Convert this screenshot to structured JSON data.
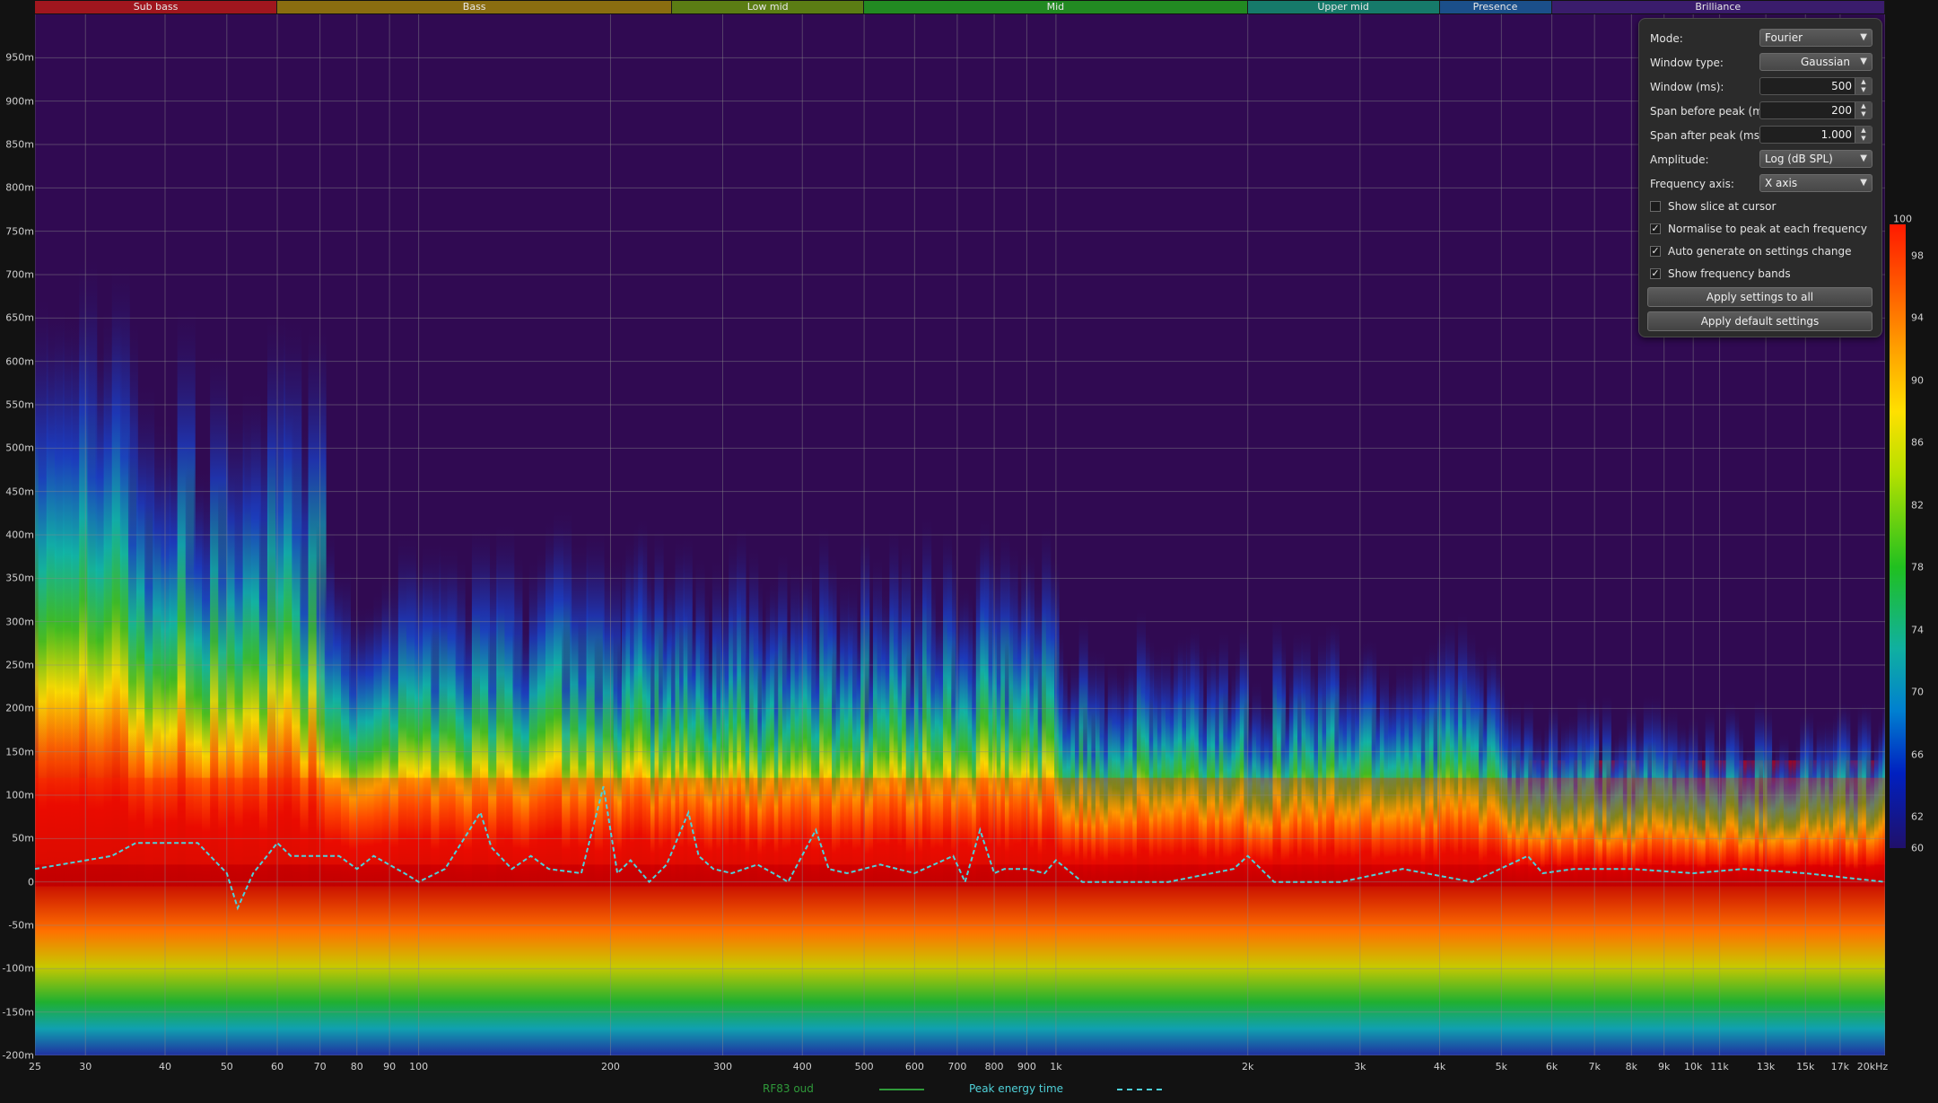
{
  "bands": [
    {
      "label": "Sub bass",
      "color": "#a0161e",
      "from": 20,
      "to": 60
    },
    {
      "label": "Bass",
      "color": "#8a6d10",
      "from": 60,
      "to": 250
    },
    {
      "label": "Low mid",
      "color": "#5b7d14",
      "from": 250,
      "to": 500
    },
    {
      "label": "Mid",
      "color": "#228a22",
      "from": 500,
      "to": 2000
    },
    {
      "label": "Upper mid",
      "color": "#167a6a",
      "from": 2000,
      "to": 4000
    },
    {
      "label": "Presence",
      "color": "#1b4f8a",
      "from": 4000,
      "to": 6000
    },
    {
      "label": "Brilliance",
      "color": "#3a1c6c",
      "from": 6000,
      "to": 20000
    }
  ],
  "axes": {
    "x": {
      "min": 25,
      "max": 20000,
      "scale": "log",
      "ticks": [
        {
          "v": 25,
          "label": "25"
        },
        {
          "v": 30,
          "label": "30"
        },
        {
          "v": 40,
          "label": "40"
        },
        {
          "v": 50,
          "label": "50"
        },
        {
          "v": 60,
          "label": "60"
        },
        {
          "v": 70,
          "label": "70"
        },
        {
          "v": 80,
          "label": "80"
        },
        {
          "v": 90,
          "label": "90"
        },
        {
          "v": 100,
          "label": "100"
        },
        {
          "v": 200,
          "label": "200"
        },
        {
          "v": 300,
          "label": "300"
        },
        {
          "v": 400,
          "label": "400"
        },
        {
          "v": 500,
          "label": "500"
        },
        {
          "v": 600,
          "label": "600"
        },
        {
          "v": 700,
          "label": "700"
        },
        {
          "v": 800,
          "label": "800"
        },
        {
          "v": 900,
          "label": "900"
        },
        {
          "v": 1000,
          "label": "1k"
        },
        {
          "v": 2000,
          "label": "2k"
        },
        {
          "v": 3000,
          "label": "3k"
        },
        {
          "v": 4000,
          "label": "4k"
        },
        {
          "v": 5000,
          "label": "5k"
        },
        {
          "v": 6000,
          "label": "6k"
        },
        {
          "v": 7000,
          "label": "7k"
        },
        {
          "v": 8000,
          "label": "8k"
        },
        {
          "v": 9000,
          "label": "9k"
        },
        {
          "v": 10000,
          "label": "10k"
        },
        {
          "v": 11000,
          "label": "11k"
        },
        {
          "v": 13000,
          "label": "13k"
        },
        {
          "v": 15000,
          "label": "15k"
        },
        {
          "v": 17000,
          "label": "17k"
        },
        {
          "v": 20000,
          "label": "20kHz"
        }
      ]
    },
    "y": {
      "min": -200,
      "max": 1000,
      "ticks": [
        {
          "v": 950,
          "label": "950m"
        },
        {
          "v": 900,
          "label": "900m"
        },
        {
          "v": 850,
          "label": "850m"
        },
        {
          "v": 800,
          "label": "800m"
        },
        {
          "v": 750,
          "label": "750m"
        },
        {
          "v": 700,
          "label": "700m"
        },
        {
          "v": 650,
          "label": "650m"
        },
        {
          "v": 600,
          "label": "600m"
        },
        {
          "v": 550,
          "label": "550m"
        },
        {
          "v": 500,
          "label": "500m"
        },
        {
          "v": 450,
          "label": "450m"
        },
        {
          "v": 400,
          "label": "400m"
        },
        {
          "v": 350,
          "label": "350m"
        },
        {
          "v": 300,
          "label": "300m"
        },
        {
          "v": 250,
          "label": "250m"
        },
        {
          "v": 200,
          "label": "200m"
        },
        {
          "v": 150,
          "label": "150m"
        },
        {
          "v": 100,
          "label": "100m"
        },
        {
          "v": 50,
          "label": "50m"
        },
        {
          "v": 0,
          "label": "0"
        },
        {
          "v": -50,
          "label": "-50m"
        },
        {
          "v": -100,
          "label": "-100m"
        },
        {
          "v": -150,
          "label": "-150m"
        },
        {
          "v": -200,
          "label": "-200m"
        }
      ]
    }
  },
  "chart_data": {
    "type": "heatmap",
    "x_range": [
      25,
      20000
    ],
    "y_range": [
      -200,
      1000
    ],
    "x_scale": "log",
    "grid": true,
    "legend_placement": "bottom",
    "series": [
      {
        "name": "Peak energy time",
        "color": "#4fd0d8",
        "style": "dashed",
        "x": [
          25,
          33,
          36,
          45,
          50,
          52,
          55,
          60,
          63,
          75,
          80,
          85,
          95,
          100,
          110,
          125,
          130,
          140,
          150,
          160,
          180,
          195,
          205,
          215,
          230,
          245,
          265,
          275,
          290,
          310,
          340,
          360,
          380,
          420,
          440,
          470,
          530,
          600,
          690,
          720,
          760,
          800,
          830,
          900,
          960,
          1000,
          1100,
          1200,
          1500,
          1900,
          2000,
          2200,
          2800,
          3500,
          4500,
          5500,
          5800,
          6500,
          8000,
          10000,
          12000,
          15000,
          20000
        ],
        "y": [
          15,
          30,
          45,
          45,
          10,
          -30,
          10,
          45,
          30,
          30,
          15,
          30,
          10,
          0,
          15,
          80,
          40,
          15,
          30,
          15,
          10,
          110,
          10,
          25,
          0,
          20,
          80,
          30,
          15,
          10,
          20,
          10,
          0,
          60,
          15,
          10,
          20,
          10,
          30,
          0,
          60,
          10,
          15,
          15,
          10,
          25,
          0,
          0,
          0,
          15,
          30,
          0,
          0,
          15,
          0,
          30,
          10,
          15,
          15,
          10,
          15,
          10,
          0
        ]
      },
      {
        "name": "RF83 oud",
        "color": "#2f9a3a",
        "style": "solid",
        "x": [],
        "y": []
      }
    ],
    "colorbar": {
      "min": 60,
      "max": 100,
      "ticks": [
        100,
        98,
        94,
        90,
        86,
        82,
        78,
        74,
        70,
        66,
        62,
        60
      ]
    }
  },
  "legend": [
    {
      "label": "RF83 oud",
      "color": "#2f9a3a",
      "style": "solid"
    },
    {
      "label": "Peak energy time",
      "color": "#4fd0d8",
      "style": "dashed"
    }
  ],
  "panel": {
    "mode": {
      "label": "Mode:",
      "value": "Fourier"
    },
    "window_type": {
      "label": "Window type:",
      "value": "Gaussian"
    },
    "window_ms": {
      "label": "Window (ms):",
      "value": "500"
    },
    "span_before": {
      "label": "Span before peak (ms):",
      "value": "200"
    },
    "span_after": {
      "label": "Span after peak (ms):",
      "value": "1.000"
    },
    "amplitude": {
      "label": "Amplitude:",
      "value": "Log (dB SPL)"
    },
    "freq_axis": {
      "label": "Frequency axis:",
      "value": "X axis"
    },
    "checks": [
      {
        "label": "Show slice at cursor",
        "checked": false
      },
      {
        "label": "Normalise to peak at each frequency",
        "checked": true
      },
      {
        "label": "Auto generate on settings change",
        "checked": true
      },
      {
        "label": "Show frequency bands",
        "checked": true
      }
    ],
    "apply_all": "Apply settings to all",
    "apply_default": "Apply default settings"
  }
}
